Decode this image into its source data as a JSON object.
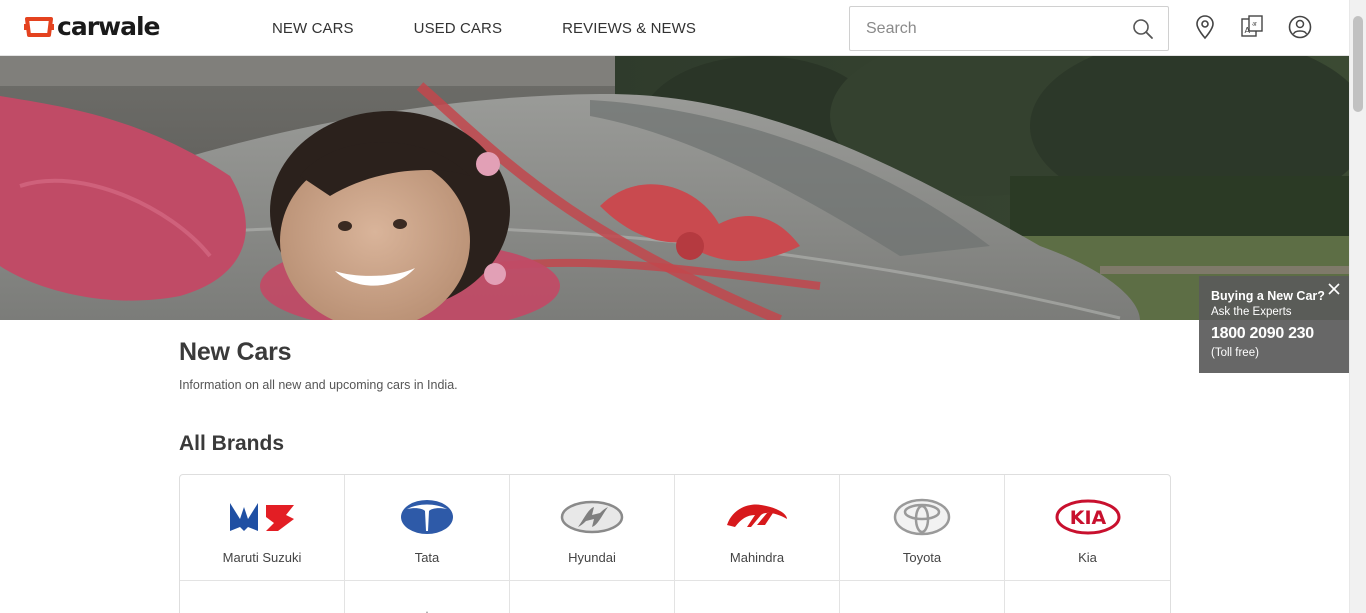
{
  "header": {
    "logo_text": "carwale",
    "nav": [
      "NEW CARS",
      "USED CARS",
      "REVIEWS & NEWS"
    ],
    "search_placeholder": "Search",
    "icons": [
      "location-icon",
      "language-icon",
      "user-account-icon"
    ]
  },
  "expert_popup": {
    "title": "Buying a New Car?",
    "subtitle": "Ask the Experts",
    "phone": "1800 2090 230",
    "note": "(Toll free)"
  },
  "page": {
    "title": "New Cars",
    "subtitle": "Information on all new and upcoming cars in India.",
    "brands_heading": "All Brands"
  },
  "brands": [
    {
      "name": "Maruti Suzuki",
      "icon": "maruti-suzuki-logo",
      "color": "#e31e24"
    },
    {
      "name": "Tata",
      "icon": "tata-logo",
      "color": "#2e5aa8"
    },
    {
      "name": "Hyundai",
      "icon": "hyundai-logo",
      "color": "#8a8a8a"
    },
    {
      "name": "Mahindra",
      "icon": "mahindra-logo",
      "color": "#d7191c"
    },
    {
      "name": "Toyota",
      "icon": "toyota-logo",
      "color": "#9a9a9a"
    },
    {
      "name": "Kia",
      "icon": "kia-logo",
      "color": "#c8102e"
    }
  ],
  "colors": {
    "brand_red": "#e4421f",
    "text_dark": "#333333",
    "popup_bg": "#5a5a5a"
  }
}
